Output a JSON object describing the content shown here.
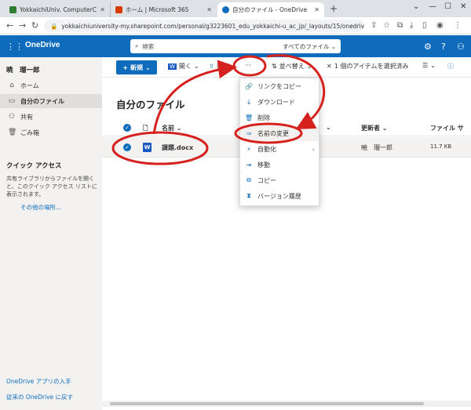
{
  "browser": {
    "tabs": [
      {
        "title": "YokkaichiUniv. ComputerCenter |",
        "favicon_color": "#2e7d32"
      },
      {
        "title": "ホーム | Microsoft 365",
        "favicon_color": "#d83b01"
      },
      {
        "title": "自分のファイル - OneDrive",
        "favicon_color": "#0f6cbd"
      }
    ],
    "url": "yokkaichiuniversity-my.sharepoint.com/personal/g3223601_edu_yokkaichi-u_ac_jp/_layouts/15/onedrive.a..."
  },
  "header": {
    "app_name": "OneDrive",
    "search_placeholder": "検索",
    "search_scope": "すべてのファイル"
  },
  "sidebar": {
    "user": "暁　瑠一郎",
    "items": [
      {
        "label": "ホーム",
        "icon": "home-icon"
      },
      {
        "label": "自分のファイル",
        "icon": "folder-icon",
        "active": true
      },
      {
        "label": "共有",
        "icon": "people-icon"
      },
      {
        "label": "ごみ箱",
        "icon": "trash-icon"
      }
    ],
    "quick_access_title": "クイック アクセス",
    "quick_access_desc": "共有ライブラリからファイルを開くと、このクイック アクセス リストに表示されます。",
    "other_places": "その他の場所...",
    "footer_links": [
      "OneDrive アプリの入手",
      "従来の OneDrive に戻す"
    ]
  },
  "commandbar": {
    "new_label": "新規",
    "open_label": "開く",
    "share_label": "共有",
    "more_label": "···",
    "sort_label": "並べ替え",
    "selected_label": "1 個のアイテムを選択済み"
  },
  "main": {
    "title": "自分のファイル",
    "columns": {
      "name": "名前",
      "modified_by": "更新者",
      "filesize": "ファイル サ"
    },
    "file": {
      "name": "課題.docx",
      "modified_by": "暁　瑠一郎",
      "size": "11.7 KB"
    }
  },
  "context_menu": [
    {
      "label": "リンクをコピー",
      "icon": "link-icon"
    },
    {
      "label": "ダウンロード",
      "icon": "download-icon"
    },
    {
      "label": "削除",
      "icon": "trash-icon"
    },
    {
      "label": "名前の変更",
      "icon": "rename-icon",
      "highlight": true
    },
    {
      "label": "自動化",
      "icon": "automate-icon",
      "submenu": true
    },
    {
      "label": "移動",
      "icon": "move-icon"
    },
    {
      "label": "コピー",
      "icon": "copy-icon"
    },
    {
      "label": "バージョン履歴",
      "icon": "history-icon"
    }
  ],
  "colors": {
    "accent": "#0f6cbd",
    "annotation": "#d6221f"
  }
}
